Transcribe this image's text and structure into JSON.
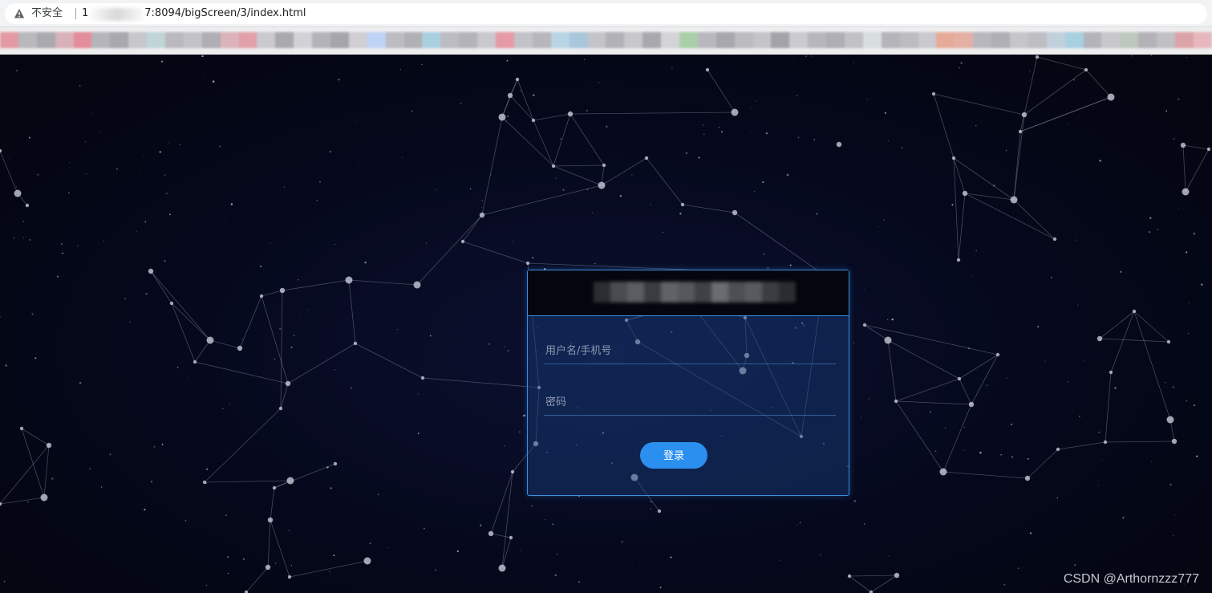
{
  "browser": {
    "security_label": "不安全",
    "url_start": "1",
    "url_end": "7:8094/bigScreen/3/index.html",
    "warning_icon": "warning-triangle-icon"
  },
  "bookmark_colors": [
    "#e39aa2",
    "#b8b8bd",
    "#a9a9af",
    "#d8b1b9",
    "#e38d9a",
    "#b5b5bb",
    "#a8a8ae",
    "#c7c7cc",
    "#bfd5d8",
    "#b9b9bf",
    "#c2c2c7",
    "#aeaeb4",
    "#dcb2bb",
    "#e1a0aa",
    "#c9c9ce",
    "#a9a9ae",
    "#d2d2d6",
    "#b3b3b9",
    "#a5a5ab",
    "#cfcfd4",
    "#bfd3f5",
    "#bcbcc1",
    "#b0b0b6",
    "#a9d0df",
    "#bcbcc2",
    "#b3b3b9",
    "#c8c8cd",
    "#e59aa5",
    "#c2c2c7",
    "#b6b6bc",
    "#b9d4e4",
    "#a9c6da",
    "#c4c4c9",
    "#b1b1b7",
    "#c7c7cc",
    "#a8a8ae",
    "#d4d4d8",
    "#a8cfa8",
    "#b8b8be",
    "#a7a7ad",
    "#bbbbc0",
    "#c4c4c9",
    "#a3a3a9",
    "#cacacf",
    "#b6b6bc",
    "#aeaeb4",
    "#c1c1c6",
    "#d8dde0",
    "#b4b4ba",
    "#bcbcc1",
    "#c9c9ce",
    "#e8aa98",
    "#e3b0a3",
    "#b7b7bd",
    "#afafb5",
    "#c5c5ca",
    "#bdbdc2",
    "#c1d1dc",
    "#a8d0e0",
    "#b3b3b9",
    "#c7c7cc",
    "#bec8be",
    "#b2b2b8",
    "#c0c0c5",
    "#dca3a8",
    "#e6b8bd"
  ],
  "login": {
    "username_placeholder": "用户名/手机号",
    "password_placeholder": "密码",
    "username_value": "",
    "password_value": "",
    "submit_label": "登录"
  },
  "watermark": "CSDN @Arthornzzz777",
  "colors": {
    "accent": "#2b8ff0",
    "box_border": "#3d8ee0",
    "background": "#05081a"
  }
}
